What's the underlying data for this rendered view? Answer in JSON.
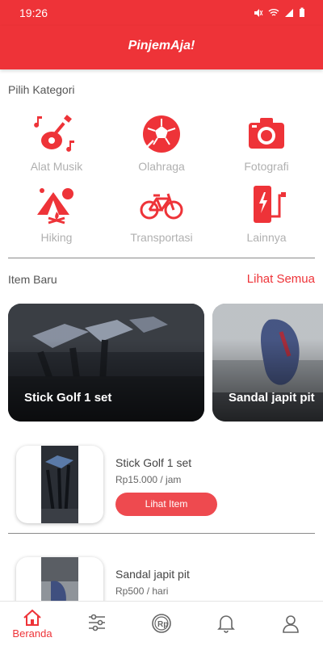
{
  "status": {
    "time": "19:26"
  },
  "app": {
    "title": "PinjemAja!"
  },
  "categories": {
    "title": "Pilih Kategori",
    "items": [
      {
        "label": "Alat Musik",
        "icon": "music-guitar-icon"
      },
      {
        "label": "Olahraga",
        "icon": "soccer-ball-icon"
      },
      {
        "label": "Fotografi",
        "icon": "camera-icon"
      },
      {
        "label": "Hiking",
        "icon": "tent-icon"
      },
      {
        "label": "Transportasi",
        "icon": "bicycle-icon"
      },
      {
        "label": "Lainnya",
        "icon": "power-bank-icon"
      }
    ]
  },
  "new_items": {
    "title": "Item Baru",
    "see_all": "Lihat Semua",
    "featured": [
      {
        "name": "Stick Golf 1 set"
      },
      {
        "name": "Sandal japit pit"
      }
    ],
    "list": [
      {
        "name": "Stick Golf 1 set",
        "price": "Rp15.000 / jam",
        "button": "Lihat Item"
      },
      {
        "name": "Sandal japit pit",
        "price": "Rp500 / hari"
      }
    ]
  },
  "nav": {
    "items": [
      {
        "label": "Beranda",
        "icon": "home-icon",
        "active": true
      },
      {
        "label": "",
        "icon": "sliders-icon"
      },
      {
        "label": "",
        "icon": "rupiah-coin-icon"
      },
      {
        "label": "",
        "icon": "bell-icon"
      },
      {
        "label": "",
        "icon": "user-icon"
      }
    ]
  },
  "colors": {
    "accent": "#ee3338",
    "button": "#ee4a4f"
  }
}
